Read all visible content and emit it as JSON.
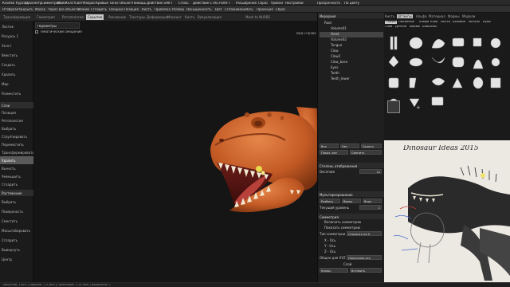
{
  "menu": [
    "Кнопка",
    "Курсор",
    "Просмотр",
    "Симметрия",
    "Файл",
    "Холст",
    "Свет",
    "Макрос",
    "Кривые",
    "Окно",
    "Объект",
    "Помощь",
    "Действие SHIFT",
    "Стиль",
    "Действие CTRL+SHIFT",
    "Расширения",
    "Сброс",
    "Уровни",
    "Настройки"
  ],
  "menu_right": [
    "Прозрачность",
    "По цвету"
  ],
  "toolbar": [
    "Отобразить",
    "Скрыть",
    "Маска",
    "Через все объекты",
    "Режим",
    "Сгладить",
    "Толщина",
    "Позиция",
    "Кисть",
    "Привязка",
    "Размер",
    "Насыщенность",
    "Шаг",
    "Сглаживание",
    "Ось",
    "Проекция",
    "Сброс"
  ],
  "tabs": [
    "Трансформация",
    "Геометрия",
    "Ретопология",
    "Скрытие",
    "Рисование",
    "Текстуры",
    "Деформация",
    "Маскинг",
    "Кисть",
    "Визуализация",
    "Mesh to NURBS"
  ],
  "active_tab": "Скрытие",
  "left_panel": {
    "items": [
      "Ластик",
      "Ресурсы 1",
      "Холст",
      "Вместить",
      "Создать",
      "Удалить",
      "Мир",
      "Разместить"
    ],
    "head1": "Слои",
    "items2": [
      "Позиция",
      "Ретопология",
      "Выбрать",
      "Сгруппировать",
      "Переместить",
      "Трансформировать",
      "Удалить",
      "Вычесть",
      "Уменьшить",
      "Сгладить"
    ],
    "head2": "Растяжение",
    "items3": [
      "Выбрать",
      "Поверхность",
      "Сместить",
      "Масштабировать",
      "Сгладить",
      "Вывернуть",
      "Центр"
    ],
    "active_item": "Удалить"
  },
  "viewport": {
    "params_label": "Параметры",
    "checkbox_label": "Тематический смещение",
    "top_right": "Вид Справа"
  },
  "status": "Масштаб: 100% | Вершин: 2.5 млн | Полигонов: 1.24 млн | Выделено: 0",
  "right_panel": {
    "title": "Иерархия",
    "tree": [
      "Root",
      "Volume01",
      "Head",
      "Volume02",
      "Tongue",
      "Claw",
      "Claw2",
      "Claw_base",
      "Eyes",
      "Teeth",
      "Teeth_lower"
    ],
    "selected_item": "Head",
    "buttons_row1": [
      "Все",
      "Нет",
      "Скрыть"
    ],
    "buttons_row2": [
      "Показ. все",
      "Сменить"
    ],
    "head_display": "Степень отображения",
    "decimate_label": "Decimate",
    "decimate_value": "1x",
    "head_subdiv": "Мультиразрешение",
    "subdiv_buttons": [
      "Разбить",
      "Вверх",
      "Вниз"
    ],
    "subdiv_level_label": "Текущий уровень",
    "subdiv_level": "1",
    "head_symmetry": "Симметрия",
    "sym_checks": [
      "Включить симметрию",
      "Показать симметрию"
    ],
    "sym_mode_label": "Тип симметрии",
    "sym_mode_value": "Отразить по X",
    "axes": [
      "X - Ось",
      "Y - Ось",
      "Z - Ось"
    ],
    "offset_label": "Общее для XYZ",
    "offset_value": "Локальная ось",
    "bottom_label": "Слой",
    "bottom_buttons": [
      "Копир.",
      "Вставить"
    ]
  },
  "brush_panel": {
    "tabs": [
      "Кисть",
      "Штампы",
      "Альфа",
      "Материал",
      "Формы",
      "Модели"
    ],
    "active_tab": "Штампы",
    "subtabs": [
      "Сферы",
      "Объемные",
      "Альфа",
      "Клей",
      "Тексты",
      "Базовые",
      "Металл",
      "Кубы",
      "Слои",
      "Детали",
      "Формы",
      "Шаблоны"
    ],
    "add_label": "+"
  },
  "reference": {
    "caption": "Dinosaur Ideas 2015"
  },
  "colors": {
    "skin": "#c8612e",
    "skin_dark": "#8a3a16",
    "teeth": "#f3e9d2",
    "gum": "#b8403a",
    "accent_yellow": "#e8d84a"
  }
}
